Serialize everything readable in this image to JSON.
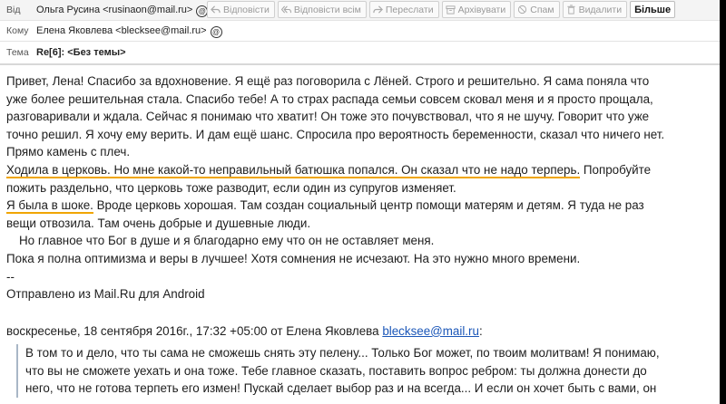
{
  "header": {
    "from_label": "Від",
    "from_value": "Ольга Русина <rusinaon@mail.ru>",
    "to_label": "Кому",
    "to_value": "Елена Яковлева <blecksee@mail.ru>",
    "subject_label": "Тема",
    "subject_re": "Re[6]:",
    "subject_value": "<Без темы>"
  },
  "toolbar": {
    "reply": "Відповісти",
    "reply_all": "Відповісти всім",
    "forward": "Переслати",
    "archive": "Архівувати",
    "spam": "Спам",
    "delete": "Видалити",
    "more": "Більше"
  },
  "body": {
    "l1": "Привет, Лена! Спасибо за вдохновение. Я ещё раз поговорила с Лёней. Строго и решительно. Я сама поняла что",
    "l2": "уже более решительная стала. Спасибо тебе! А то страх распада семьи совсем сковал меня и я просто прощала,",
    "l3": "разговаривали и ждала. Сейчас я понимаю что хватит! Он тоже это почувствовал, что я не шучу. Говорит что уже",
    "l4": "точно решил. Я хочу ему верить. И дам ещё шанс. Спросила про вероятность беременности, сказал что ничего нет.",
    "l5": "Прямо камень с плеч.",
    "l6_hl": "Ходила в церковь. Но мне какой-то неправильный батюшка попался. Он сказал что не надо терперь.",
    "l6_rest": " Попробуйте",
    "l7": "пожить раздельно, что церковь тоже разводит, если один из супругов изменяет.",
    "l8_hl": "Я была в шоке.",
    "l8_rest": " Вроде церковь хорошая. Там создан социальный центр помощи матерям и детям. Я туда не раз",
    "l9": "вещи отвозила. Там очень добрые и душевные люди.",
    "l10": "Но главное что Бог в душе и я благодарно ему что он не оставляет меня.",
    "l11": "Пока я полна оптимизма и веры в лучшее! Хотя сомнения не исчезают. На это нужно много времени.",
    "l12": "--",
    "l13": "Отправлено из Mail.Ru для Android",
    "meta_prefix": "воскресенье, 18 сентября 2016г., 17:32 +05:00 от Елена Яковлева ",
    "meta_link": "blecksee@mail.ru",
    "meta_suffix": ":"
  },
  "quote": {
    "q1": "В том то и дело, что ты сама не сможешь снять эту пелену... Только Бог может, по твоим молитвам! Я понимаю,",
    "q2": "что вы не сможете уехать и она тоже. Тебе главное сказать, поставить вопрос ребром: ты должна донести до",
    "q3": "него, что не готова терпеть его измен! Пускай сделает выбор раз и на всегда... И если он хочет быть с вами, он"
  },
  "icons": {
    "from_contact": "at-sign-icon",
    "to_contact": "at-sign-icon"
  }
}
